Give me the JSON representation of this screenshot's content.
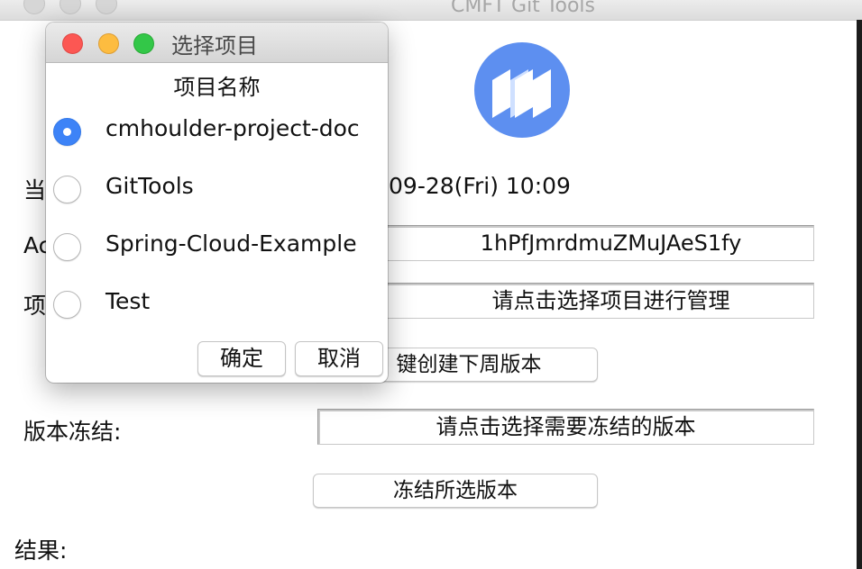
{
  "main_window": {
    "title": "CMFT Git Tools",
    "time_label_partial": "当",
    "time_value": "-09-28(Fri) 10:09",
    "account_label_partial": "Ac",
    "account_value": "1hPfJmrdmuZMuJAeS1fy",
    "project_label_partial": "项",
    "project_selector": "请点击选择项目进行管理",
    "create_next_week_button": "键创建下周版本",
    "freeze_label": "版本冻结:",
    "freeze_selector": "请点击选择需要冻结的版本",
    "freeze_button": "冻结所选版本",
    "result_label": "结果:"
  },
  "dialog": {
    "title": "选择项目",
    "header": "项目名称",
    "options": [
      {
        "label": "cmhoulder-project-doc",
        "selected": true
      },
      {
        "label": "GitTools",
        "selected": false
      },
      {
        "label": "Spring-Cloud-Example",
        "selected": false
      },
      {
        "label": "Test",
        "selected": false
      }
    ],
    "ok_label": "确定",
    "cancel_label": "取消"
  },
  "colors": {
    "accent": "#3d83f7",
    "logo": "#5d8ff0"
  }
}
